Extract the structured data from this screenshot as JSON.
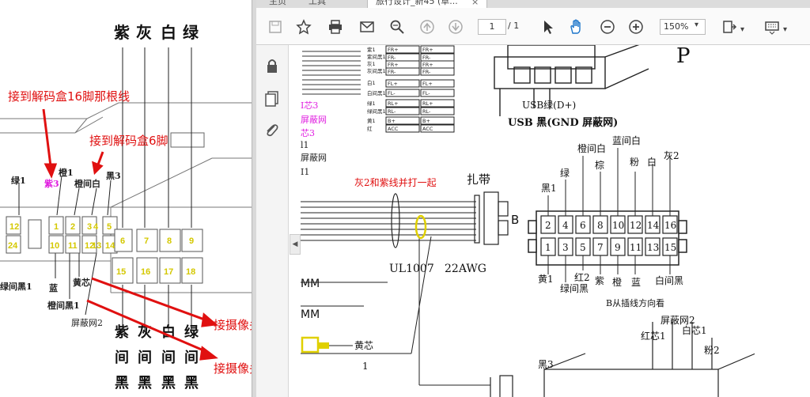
{
  "left_doc": {
    "colors_top": [
      "紫",
      "灰",
      "白",
      "绿"
    ],
    "colors_bottom": [
      [
        "紫",
        "间",
        "黑"
      ],
      [
        "灰",
        "间",
        "黑"
      ],
      [
        "白",
        "间",
        "黑"
      ],
      [
        "绿",
        "间",
        "黑"
      ]
    ],
    "annotations": {
      "pin16": "接到解码盒16脚那根线",
      "pin6": "接到解码盒6脚",
      "rca_yellow": "接摄像头RCA的黄芯线",
      "rca_shield": "接摄像头RCA的屏蔽网"
    },
    "wire_labels": {
      "green1": "绿1",
      "purple3": "紫3",
      "orange1": "橙1",
      "orange_white": "橙间白",
      "black3": "黑3",
      "blue": "蓝",
      "yellow_core": "黄芯",
      "orange_black1": "橙间黑1",
      "green_black1": "绿间黑1",
      "shield2": "屏蔽网2"
    },
    "pins_top": [
      "12",
      "1",
      "2",
      "3",
      "4",
      "5",
      "6",
      "7",
      "8",
      "9"
    ],
    "pins_bottom": [
      "24",
      "10",
      "11",
      "12",
      "13",
      "14",
      "15",
      "16",
      "17",
      "18"
    ]
  },
  "toolbar": {
    "tabs": [
      "主页",
      "工具",
      "旅行设计_新45 (草..."
    ],
    "page_current": "1",
    "page_total": "/ 1",
    "zoom": "150%"
  },
  "right_doc": {
    "letter_p": "P",
    "usb_green": "USB绿(D+)",
    "usb_black": "USB 黑(GND 屏蔽网)",
    "tie_note": "灰2和紫线并打一起",
    "strap": "扎带",
    "conn_b": "B",
    "ul": "UL1007",
    "awg": "22AWG",
    "view_note": "B从插线方向看",
    "mm1": "MM",
    "mm2": "MM",
    "yellow_core": "黄芯",
    "left_texts": [
      "I芯3",
      "屏蔽网",
      "芯3",
      "l1",
      "屏蔽网",
      "I1"
    ],
    "table_rows": [
      [
        "紫1",
        "FR+",
        "FR+"
      ],
      [
        "紫间黑1",
        "FR-",
        "FR-"
      ],
      [
        "灰1",
        "FR+",
        "FR+"
      ],
      [
        "灰间黑1",
        "FR-",
        "FR-"
      ],
      [
        "白1",
        "FL+",
        "FL+"
      ],
      [
        "白间黑1",
        "FL-",
        "FL-"
      ],
      [
        "绿1",
        "RL+",
        "RL+"
      ],
      [
        "绿间黑1",
        "RL-",
        "RL-"
      ],
      [
        "黄1",
        "B+",
        "B+"
      ],
      [
        "红",
        "ACC",
        "ACC"
      ]
    ],
    "pins_top": [
      "2",
      "4",
      "6",
      "8",
      "10",
      "12",
      "14",
      "16"
    ],
    "pins_bottom": [
      "1",
      "3",
      "5",
      "7",
      "9",
      "11",
      "13",
      "15"
    ],
    "top_wires": [
      "黑1",
      "绿",
      "橙间白",
      "棕",
      "蓝间白",
      "粉",
      "白",
      "灰2"
    ],
    "bottom_wires": [
      "黄1",
      "绿间黑",
      "红2",
      "紫",
      "橙",
      "蓝",
      "白间黑"
    ],
    "lower_labels": [
      "黑3",
      "红芯1",
      "屏蔽网2",
      "白芯1",
      "粉2"
    ]
  }
}
